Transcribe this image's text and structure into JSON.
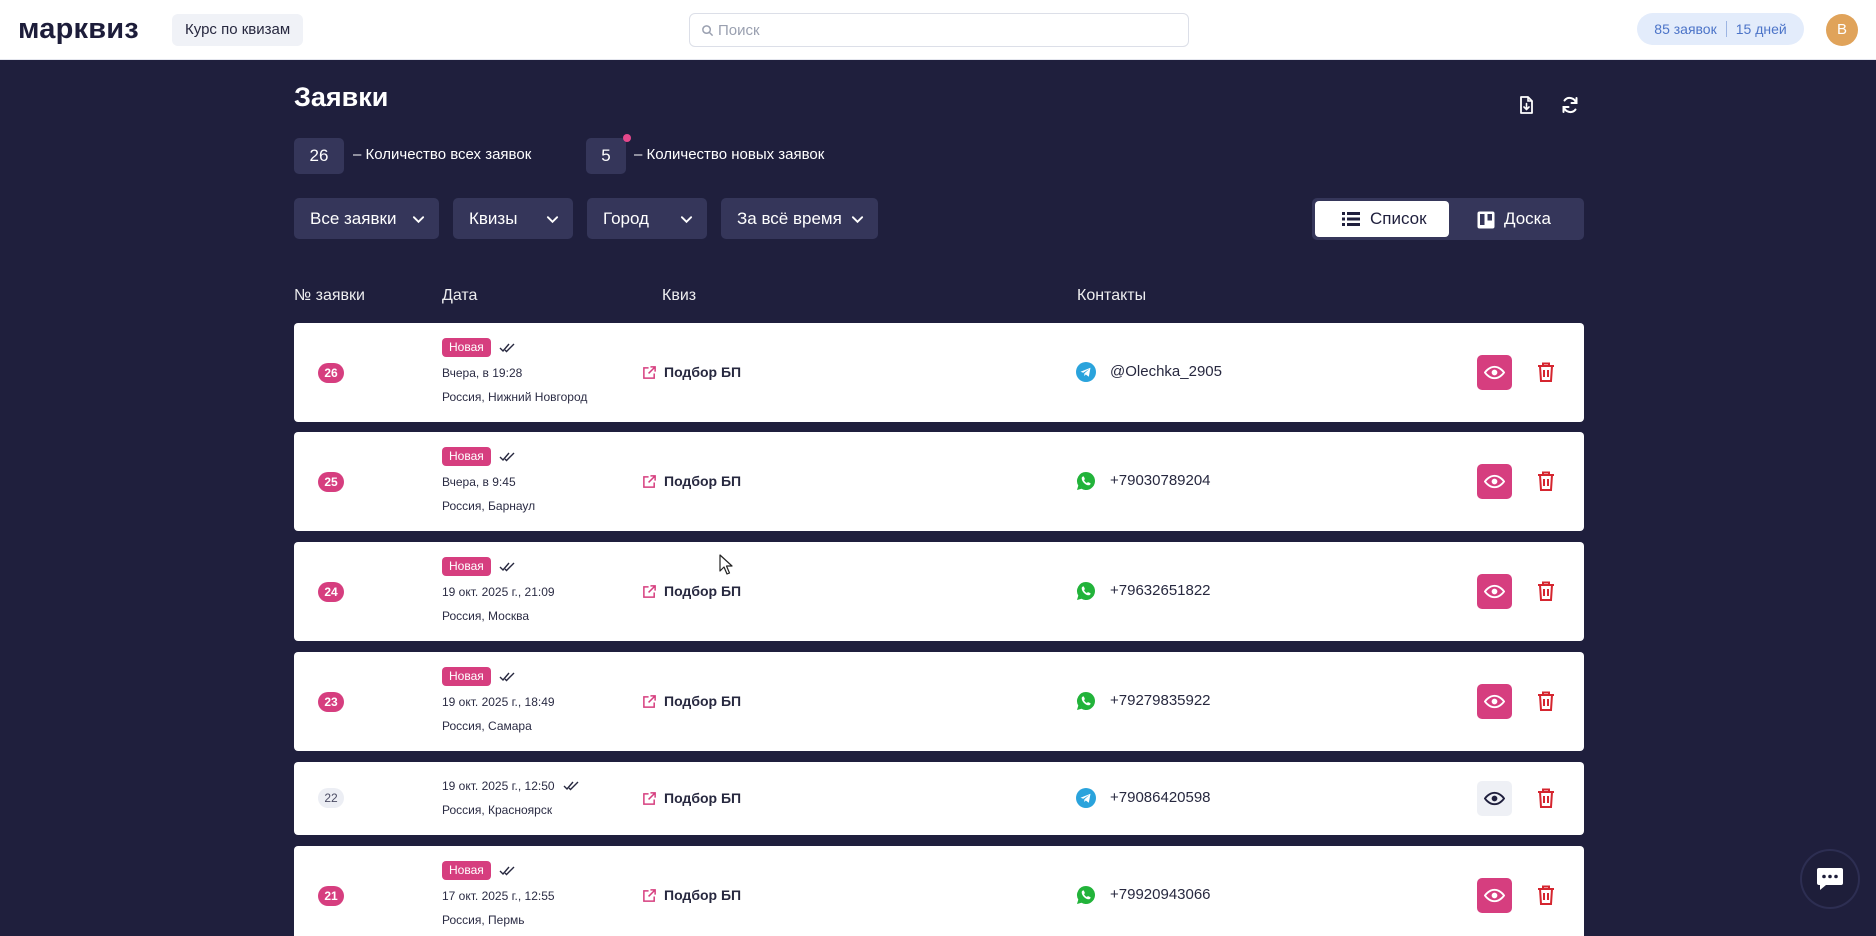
{
  "header": {
    "logo": "марквиз",
    "course_button": "Курс по квизам",
    "search_placeholder": "Поиск",
    "leads_limit": "85 заявок",
    "days_limit": "15 дней",
    "avatar_letter": "В"
  },
  "page": {
    "title": "Заявки",
    "total_count": "26",
    "total_label": "–  Количество всех заявок",
    "new_count": "5",
    "new_label": "–  Количество новых заявок"
  },
  "filters": {
    "status": "Все заявки",
    "quizzes": "Квизы",
    "city": "Город",
    "period": "За всё время"
  },
  "view_toggle": {
    "list_label": "Список",
    "board_label": "Доска",
    "active": "list"
  },
  "table": {
    "columns": [
      "№ заявки",
      "Дата",
      "Квиз",
      "Контакты"
    ],
    "rows": [
      {
        "num": "26",
        "status": "Новая",
        "date": "Вчера, в 19:28",
        "city": "Россия, Нижний Новгород",
        "quiz": "Подбор БП",
        "contact": "@Olechka_2905",
        "channel": "telegram",
        "is_new": true
      },
      {
        "num": "25",
        "status": "Новая",
        "date": "Вчера, в 9:45",
        "city": "Россия, Барнаул",
        "quiz": "Подбор БП",
        "contact": "+79030789204",
        "channel": "whatsapp",
        "is_new": true
      },
      {
        "num": "24",
        "status": "Новая",
        "date": "19 окт. 2025 г., 21:09",
        "city": "Россия, Москва",
        "quiz": "Подбор БП",
        "contact": "+79632651822",
        "channel": "whatsapp",
        "is_new": true
      },
      {
        "num": "23",
        "status": "Новая",
        "date": "19 окт. 2025 г., 18:49",
        "city": "Россия, Самара",
        "quiz": "Подбор БП",
        "contact": "+79279835922",
        "channel": "whatsapp",
        "is_new": true
      },
      {
        "num": "22",
        "status": "",
        "date": "19 окт. 2025 г., 12:50",
        "city": "Россия, Красноярск",
        "quiz": "Подбор БП",
        "contact": "+79086420598",
        "channel": "telegram",
        "is_new": false
      },
      {
        "num": "21",
        "status": "Новая",
        "date": "17 окт. 2025 г., 12:55",
        "city": "Россия, Пермь",
        "quiz": "Подбор БП",
        "contact": "+79920943066",
        "channel": "whatsapp",
        "is_new": true
      }
    ]
  },
  "colors": {
    "background": "#1f1f3d",
    "accent_pink": "#d63e7f",
    "panel": "#35365a",
    "delete_red": "#d5252f"
  },
  "icons": {
    "export": "file-export-icon",
    "refresh": "refresh-icon",
    "view": "eye-icon",
    "delete": "trash-icon",
    "quiz_link": "external-link-icon",
    "telegram": "telegram-icon",
    "whatsapp": "whatsapp-icon",
    "chat": "chat-bubble-icon"
  }
}
